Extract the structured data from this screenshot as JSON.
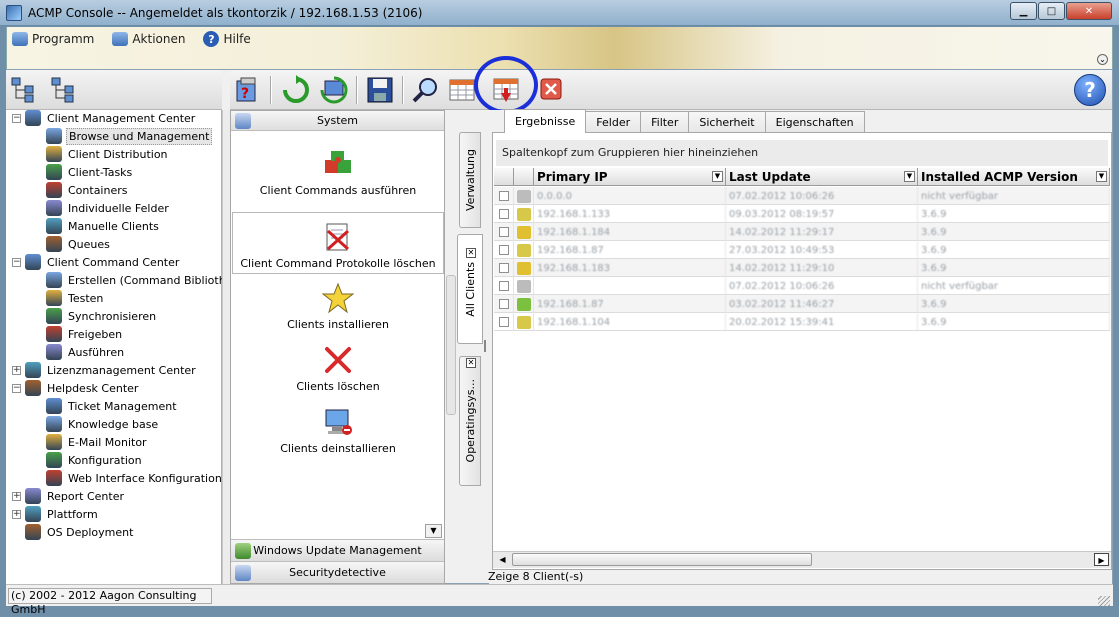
{
  "window": {
    "title": "ACMP Console -- Angemeldet als tkontorzik / 192.168.1.53 (2106)",
    "minimize": "▁",
    "maximize": "□",
    "close": "✕"
  },
  "menu": {
    "items": [
      {
        "label": "Programm",
        "icon": "program-icon"
      },
      {
        "label": "Aktionen",
        "icon": "actions-icon"
      },
      {
        "label": "Hilfe",
        "icon": "help-icon"
      }
    ]
  },
  "tree": {
    "nodes": [
      {
        "label": "Client Management Center",
        "level": 0,
        "expander": "−"
      },
      {
        "label": "Browse und Management",
        "level": 1,
        "selected": true
      },
      {
        "label": "Client Distribution",
        "level": 1
      },
      {
        "label": "Client-Tasks",
        "level": 1
      },
      {
        "label": "Containers",
        "level": 1
      },
      {
        "label": "Individuelle Felder",
        "level": 1
      },
      {
        "label": "Manuelle Clients",
        "level": 1
      },
      {
        "label": "Queues",
        "level": 1
      },
      {
        "label": "Client Command Center",
        "level": 0,
        "expander": "−"
      },
      {
        "label": "Erstellen (Command Bibliothek)",
        "level": 1
      },
      {
        "label": "Testen",
        "level": 1
      },
      {
        "label": "Synchronisieren",
        "level": 1
      },
      {
        "label": "Freigeben",
        "level": 1
      },
      {
        "label": "Ausführen",
        "level": 1
      },
      {
        "label": "Lizenzmanagement Center",
        "level": 0,
        "expander": "+"
      },
      {
        "label": "Helpdesk Center",
        "level": 0,
        "expander": "−"
      },
      {
        "label": "Ticket Management",
        "level": 1
      },
      {
        "label": "Knowledge base",
        "level": 1
      },
      {
        "label": "E-Mail Monitor",
        "level": 1
      },
      {
        "label": "Konfiguration",
        "level": 1
      },
      {
        "label": "Web Interface Konfiguration",
        "level": 1
      },
      {
        "label": "Report Center",
        "level": 0,
        "expander": "+"
      },
      {
        "label": "Plattform",
        "level": 0,
        "expander": "+"
      },
      {
        "label": "OS Deployment",
        "level": 0,
        "expander": ""
      }
    ]
  },
  "commands": {
    "header": "System",
    "items": [
      "Client Commands ausführen",
      "Client Command Protokolle löschen",
      "Clients installieren",
      "Clients löschen",
      "Clients deinstallieren"
    ],
    "footer": [
      "Windows Update Management",
      "Securitydetective"
    ],
    "scroll_down": "▼"
  },
  "side_tabs": {
    "verwaltung": "Verwaltung",
    "all_clients": "All Clients",
    "operatingsys": "Operatingsys...",
    "close": "✕"
  },
  "results": {
    "tabs": [
      "Ergebnisse",
      "Felder",
      "Filter",
      "Sicherheit",
      "Eigenschaften"
    ],
    "group_hint": "Spaltenkopf zum Gruppieren hier hineinziehen",
    "columns": [
      "Primary IP",
      "Last Update",
      "Installed ACMP Version"
    ],
    "dropdown_glyph": "▼",
    "rows": [
      {
        "ip": "0.0.0.0",
        "update": "07.02.2012 10:06:26",
        "version": "nicht verfügbar",
        "icon_color": "#bcbcbc"
      },
      {
        "ip": "192.168.1.133",
        "update": "09.03.2012 08:19:57",
        "version": "3.6.9",
        "icon_color": "#d7c84a"
      },
      {
        "ip": "192.168.1.184",
        "update": "14.02.2012 11:29:17",
        "version": "3.6.9",
        "icon_color": "#e0c030"
      },
      {
        "ip": "192.168.1.87",
        "update": "27.03.2012 10:49:53",
        "version": "3.6.9",
        "icon_color": "#d7c84a"
      },
      {
        "ip": "192.168.1.183",
        "update": "14.02.2012 11:29:10",
        "version": "3.6.9",
        "icon_color": "#e0c030"
      },
      {
        "ip": "",
        "update": "07.02.2012 10:06:26",
        "version": "nicht verfügbar",
        "icon_color": "#bcbcbc"
      },
      {
        "ip": "192.168.1.87",
        "update": "03.02.2012 11:46:27",
        "version": "3.6.9",
        "icon_color": "#7cc040"
      },
      {
        "ip": "192.168.1.104",
        "update": "20.02.2012 15:39:41",
        "version": "3.6.9",
        "icon_color": "#d7c84a"
      }
    ],
    "count_text": "Zeige 8 Client(-s)",
    "scroll_left": "◀",
    "scroll_right": "▶"
  },
  "status": {
    "copyright": "(c) 2002 - 2012 Aagon Consulting GmbH"
  },
  "help_button": "?",
  "banner_chevron": "⌄"
}
